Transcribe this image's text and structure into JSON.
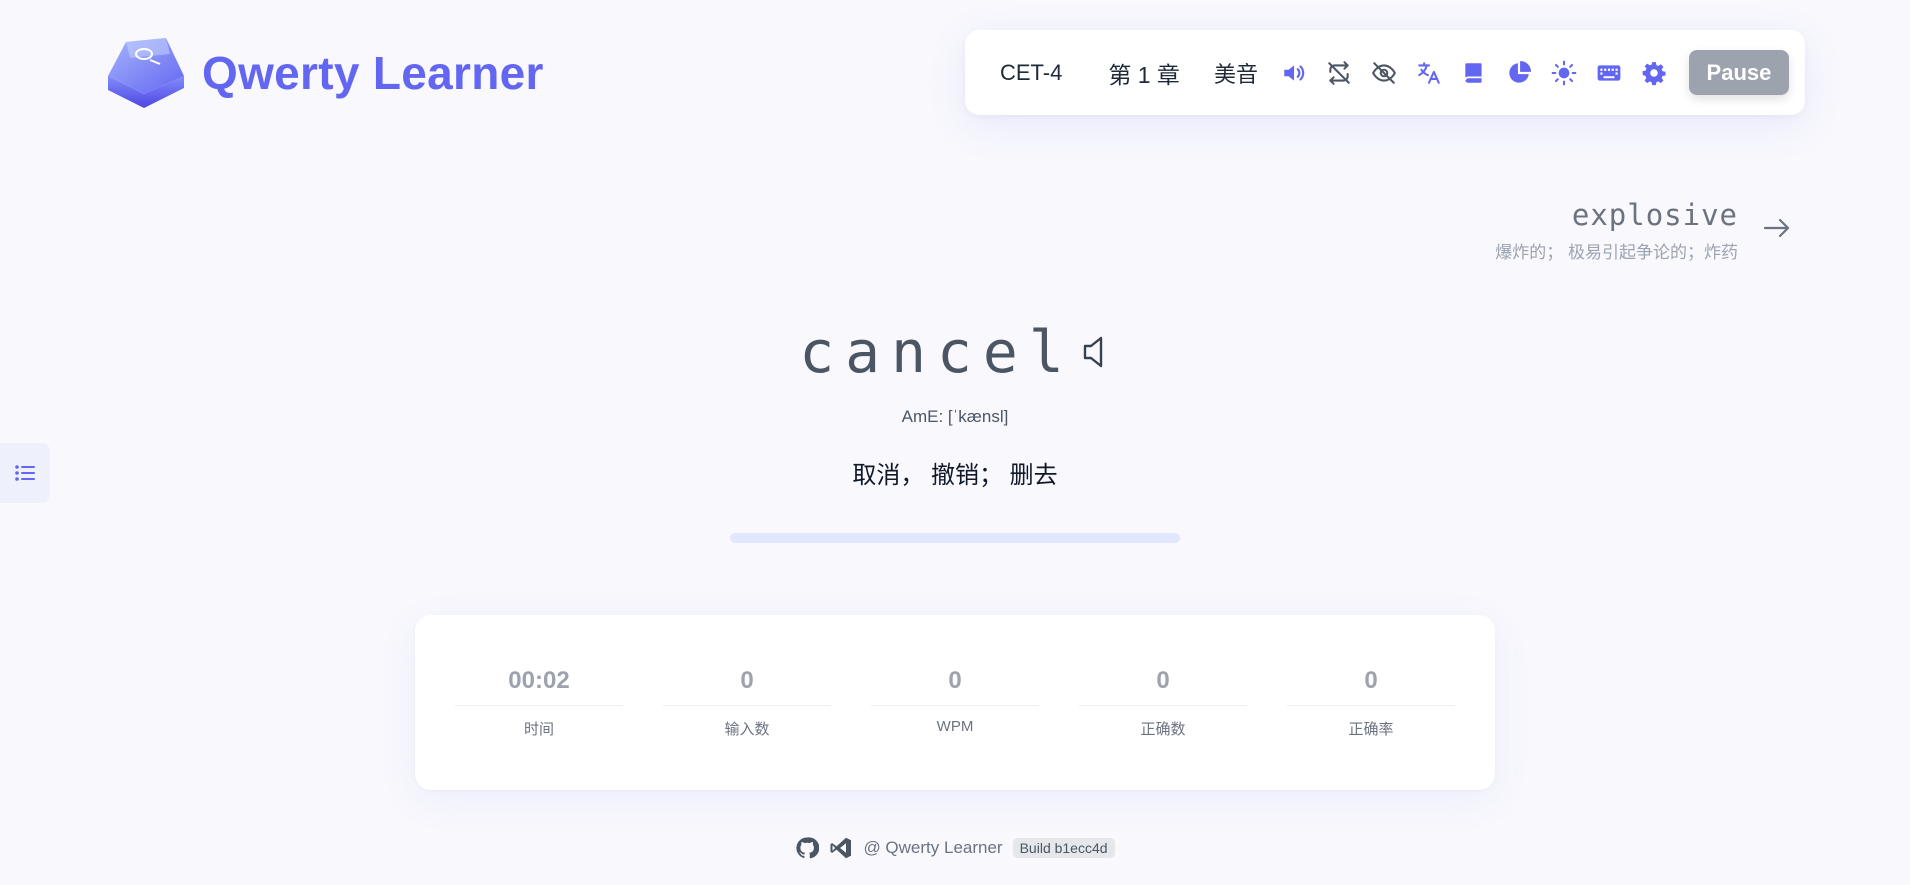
{
  "app": {
    "title": "Qwerty Learner"
  },
  "toolbar": {
    "dictionary": "CET-4",
    "chapter": "第 1 章",
    "accent": "美音",
    "icons": [
      "volume-icon",
      "loop-off-icon",
      "eye-off-icon",
      "translate-icon",
      "book-icon",
      "pie-chart-icon",
      "sun-icon",
      "keyboard-icon",
      "gear-icon"
    ],
    "pause_label": "Pause"
  },
  "next_word": {
    "word": "explosive",
    "translation": "爆炸的； 极易引起争论的；炸药"
  },
  "current_word": {
    "word": "cancel",
    "phonetic": "AmE: [ˈkænsl]",
    "translation": "取消， 撤销； 删去",
    "progress": 0
  },
  "stats": [
    {
      "value": "00:02",
      "label": "时间"
    },
    {
      "value": "0",
      "label": "输入数"
    },
    {
      "value": "0",
      "label": "WPM"
    },
    {
      "value": "0",
      "label": "正确数"
    },
    {
      "value": "0",
      "label": "正确率"
    }
  ],
  "footer": {
    "text": "@ Qwerty Learner",
    "build": "Build b1ecc4d"
  },
  "colors": {
    "accent": "#6366f1",
    "pause_bg": "#9ca3af",
    "progress_track": "#e0e7ff",
    "background": "#f8f8fd"
  }
}
